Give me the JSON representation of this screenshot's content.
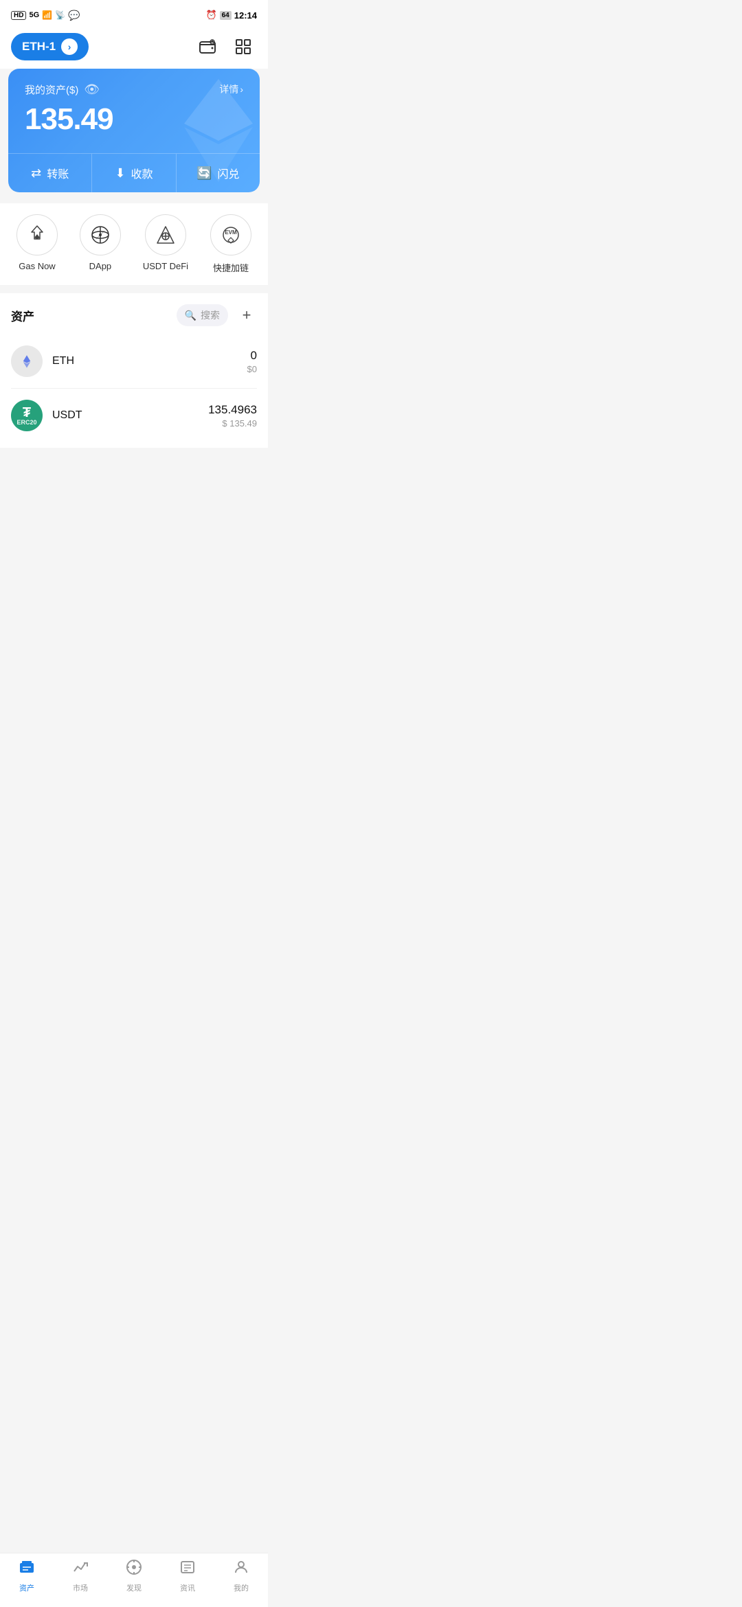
{
  "statusBar": {
    "left": "HD 5G",
    "battery": "64",
    "time": "12:14"
  },
  "header": {
    "networkLabel": "ETH-1",
    "walletIcon": "wallet",
    "scanIcon": "scan"
  },
  "assetCard": {
    "label": "我的资产($)",
    "detailLabel": "详情",
    "amount": "135.49",
    "actions": [
      {
        "icon": "⇄",
        "label": "转账"
      },
      {
        "icon": "↓",
        "label": "收款"
      },
      {
        "icon": "↻",
        "label": "闪兑"
      }
    ]
  },
  "quickAccess": [
    {
      "id": "gas-now",
      "label": "Gas Now"
    },
    {
      "id": "dapp",
      "label": "DApp"
    },
    {
      "id": "usdt-defi",
      "label": "USDT DeFi"
    },
    {
      "id": "quick-chain",
      "label": "快捷加链"
    }
  ],
  "assets": {
    "title": "资产",
    "searchPlaceholder": "搜索",
    "items": [
      {
        "symbol": "ETH",
        "name": "ETH",
        "balance": "0",
        "usd": "$0"
      },
      {
        "symbol": "USDT",
        "name": "USDT",
        "balance": "135.4963",
        "usd": "$ 135.49"
      }
    ]
  },
  "bottomNav": [
    {
      "id": "assets",
      "label": "资产",
      "active": true
    },
    {
      "id": "market",
      "label": "市场",
      "active": false
    },
    {
      "id": "discover",
      "label": "发现",
      "active": false
    },
    {
      "id": "news",
      "label": "资讯",
      "active": false
    },
    {
      "id": "profile",
      "label": "我的",
      "active": false
    }
  ]
}
